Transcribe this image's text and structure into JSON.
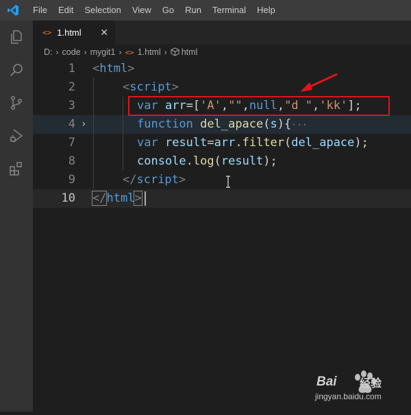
{
  "menu": {
    "items": [
      "File",
      "Edit",
      "Selection",
      "View",
      "Go",
      "Run",
      "Terminal",
      "Help"
    ]
  },
  "activity_bar": {
    "icons": [
      "explorer-icon",
      "search-icon",
      "source-control-icon",
      "run-debug-icon",
      "extensions-icon"
    ]
  },
  "tab": {
    "icon": "<>",
    "label": "1.html",
    "close": "✕"
  },
  "breadcrumb": {
    "drive": "D:",
    "folder1": "code",
    "folder2": "mygit1",
    "file": "1.html",
    "symbol": "html",
    "file_icon": "<>"
  },
  "editor": {
    "line_numbers": [
      "1",
      "2",
      "3",
      "4",
      "7",
      "8",
      "9",
      "10"
    ],
    "lines": {
      "l1": [
        "<",
        "html",
        ">"
      ],
      "l2": [
        "<",
        "script",
        ">"
      ],
      "l3": [
        "var",
        " ",
        "arr",
        "=[",
        "'A'",
        ",",
        "\"\"",
        ",",
        "null",
        ",",
        "\"d \"",
        ",",
        "'kk'",
        "];"
      ],
      "l4": [
        "function",
        " ",
        "del_apace",
        "(",
        "s",
        "){",
        "···"
      ],
      "l7": [
        "var",
        " ",
        "result",
        "=",
        "arr",
        ".",
        "filter",
        "(",
        "del_apace",
        ");"
      ],
      "l8": [
        "console",
        ".",
        "log",
        "(",
        "result",
        ");"
      ],
      "l9": [
        "</",
        "script",
        ">"
      ],
      "l10": [
        "</",
        "html",
        ">"
      ]
    },
    "fold_chevron": "›"
  },
  "watermark": {
    "brand": "Bai",
    "suffix": "经验",
    "url": "jingyan.baidu.com"
  }
}
